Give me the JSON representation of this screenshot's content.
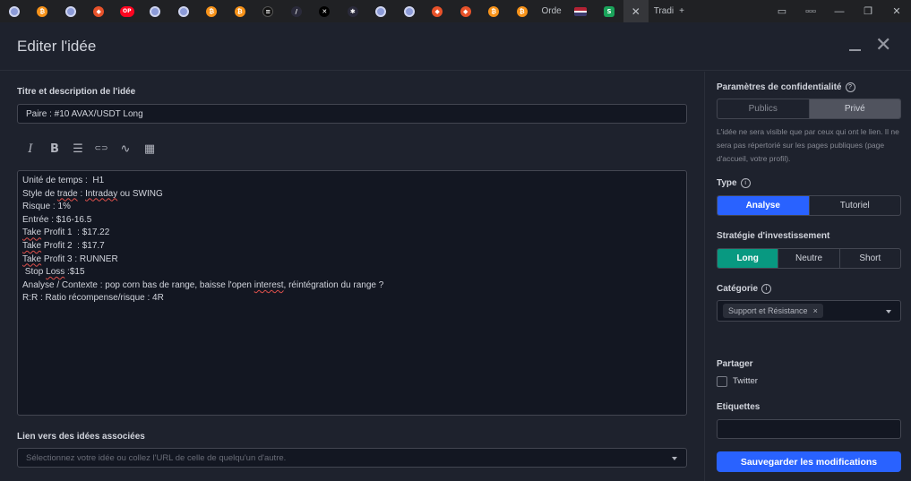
{
  "browser": {
    "tabs": [
      {
        "icon": "eth-icon",
        "kind": "eth"
      },
      {
        "icon": "bitcoin-icon",
        "kind": "btc",
        "glyph": "₿"
      },
      {
        "icon": "eth-icon",
        "kind": "eth"
      },
      {
        "icon": "brave-icon",
        "kind": "red",
        "glyph": "◆"
      },
      {
        "icon": "optimism-icon",
        "kind": "op",
        "glyph": "OP"
      },
      {
        "icon": "eth-icon",
        "kind": "eth"
      },
      {
        "icon": "eth-icon",
        "kind": "eth"
      },
      {
        "icon": "bitcoin-icon",
        "kind": "btc",
        "glyph": "₿"
      },
      {
        "icon": "bitcoin-icon",
        "kind": "btc",
        "glyph": "₿"
      },
      {
        "icon": "list-icon",
        "kind": "dark",
        "glyph": "≡"
      },
      {
        "icon": "feather-icon",
        "kind": "star",
        "glyph": "/"
      },
      {
        "icon": "x-icon",
        "kind": "x",
        "glyph": "✕"
      },
      {
        "icon": "star-icon",
        "kind": "star",
        "glyph": "✱"
      },
      {
        "icon": "eth-icon",
        "kind": "eth"
      },
      {
        "icon": "eth-icon",
        "kind": "eth"
      },
      {
        "icon": "brave-icon",
        "kind": "red",
        "glyph": "◆"
      },
      {
        "icon": "brave-icon",
        "kind": "red",
        "glyph": "◆"
      },
      {
        "icon": "bitcoin-icon",
        "kind": "btc",
        "glyph": "₿"
      },
      {
        "icon": "bitcoin-icon",
        "kind": "btc",
        "glyph": "₿"
      }
    ],
    "text_tab_1": "Orde",
    "flag_tab_icon": "us-flag-icon",
    "stake_tab_glyph": "S",
    "active_tab_close": "✕",
    "last_tab": "Tradi",
    "new_tab": "+",
    "window_controls": [
      "▭",
      "▫▫▫",
      "—",
      "❐",
      "✕"
    ]
  },
  "modal": {
    "title": "Editer l'idée",
    "close_glyph": "✕",
    "title_section_label": "Titre et description de l'idée",
    "title_value": "Paire : #10 AVAX/USDT Long",
    "toolbar": [
      {
        "name": "italic-icon",
        "glyph": "I"
      },
      {
        "name": "bold-icon",
        "glyph": "B"
      },
      {
        "name": "bullet-list-icon",
        "glyph": "☰"
      },
      {
        "name": "link-icon",
        "glyph": "⊂⊃"
      },
      {
        "name": "chart-line-icon",
        "glyph": "∿"
      },
      {
        "name": "chart-bar-icon",
        "glyph": "▦"
      }
    ],
    "description_lines": [
      [
        {
          "t": "Unité de temps :  H1"
        }
      ],
      [
        {
          "t": "Style de "
        },
        {
          "t": "trade",
          "sp": true
        },
        {
          "t": " : "
        },
        {
          "t": "Intraday",
          "sp": true
        },
        {
          "t": " ou SWING"
        }
      ],
      [
        {
          "t": "Risque : 1%"
        }
      ],
      [
        {
          "t": "Entrée : $16-16.5"
        }
      ],
      [
        {
          "t": "Take",
          "sp": true
        },
        {
          "t": " Profit 1  : $17.22"
        }
      ],
      [
        {
          "t": "Take",
          "sp": true
        },
        {
          "t": " Profit 2  : $17.7"
        }
      ],
      [
        {
          "t": "Take",
          "sp": true
        },
        {
          "t": " Profit 3 : RUNNER"
        }
      ],
      [
        {
          "t": " Stop "
        },
        {
          "t": "Loss",
          "sp": true
        },
        {
          "t": " :$15"
        }
      ],
      [
        {
          "t": "Analyse / Contexte : pop corn bas de range, baisse l'open "
        },
        {
          "t": "interest",
          "sp": true
        },
        {
          "t": ", réintégration du range ?"
        }
      ],
      [
        {
          "t": "R:R : Ratio récompense/risque : 4R"
        }
      ]
    ],
    "related_label": "Lien vers des idées associées",
    "related_placeholder": "Sélectionnez votre idée ou collez l'URL de celle de quelqu'un d'autre."
  },
  "sidebar": {
    "privacy_label": "Paramètres de confidentialité",
    "help_glyph": "?",
    "privacy_options": [
      "Publics",
      "Privé"
    ],
    "privacy_selected": 1,
    "privacy_help": "L'idée ne sera visible que par ceux qui ont le lien. Il ne sera pas répertorié sur les pages publiques (page d'accueil, votre profil).",
    "type_label": "Type",
    "info_glyph": "i",
    "type_options": [
      "Analyse",
      "Tutoriel"
    ],
    "type_selected": 0,
    "strategy_label": "Stratégie d'investissement",
    "strategy_options": [
      "Long",
      "Neutre",
      "Short"
    ],
    "strategy_selected": 0,
    "category_label": "Catégorie",
    "category_chip": "Support et Résistance",
    "chip_remove": "×",
    "share_label": "Partager",
    "twitter_label": "Twitter",
    "twitter_checked": false,
    "tags_label": "Etiquettes",
    "tags_value": "",
    "save_label": "Sauvegarder les modifications"
  },
  "colors": {
    "accent_blue": "#2962ff",
    "long_green": "#089981",
    "selected_gray": "#50535e",
    "panel_bg": "#1e222d",
    "input_bg": "#131722"
  }
}
